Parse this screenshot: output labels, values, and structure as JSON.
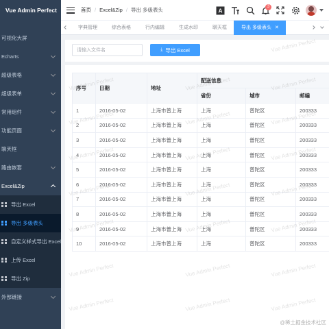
{
  "app": {
    "title": "Vue Admin Perfect"
  },
  "sidebar": {
    "items": [
      {
        "label": "可视化大屏",
        "arrow": false
      },
      {
        "label": "Echarts",
        "arrow": true
      },
      {
        "label": "超级表格",
        "arrow": true
      },
      {
        "label": "超级表单",
        "arrow": true
      },
      {
        "label": "常用组件",
        "arrow": true
      },
      {
        "label": "功能页面",
        "arrow": true
      },
      {
        "label": "聊天框",
        "arrow": false
      },
      {
        "label": "路由嵌套",
        "arrow": true
      }
    ],
    "open_group": {
      "label": "Excel&Zip",
      "children": [
        {
          "label": "导出 Excel",
          "active": false
        },
        {
          "label": "导出 多级表头",
          "active": true
        },
        {
          "label": "自定义样式导出 Excel",
          "active": false
        },
        {
          "label": "上传 Excel",
          "active": false
        },
        {
          "label": "导出 Zip",
          "active": false
        }
      ]
    },
    "after_items": [
      {
        "label": "外部链接",
        "arrow": true
      }
    ]
  },
  "header": {
    "breadcrumb": [
      "首页",
      "Excel&Zip",
      "导出 多级表头"
    ],
    "notification_count": "3",
    "icons": [
      "font-size-icon",
      "text-height-icon",
      "search-icon",
      "bell-icon",
      "fullscreen-icon",
      "settings-icon"
    ]
  },
  "tabs": [
    {
      "label": "字典管理",
      "active": false
    },
    {
      "label": "综合表格",
      "active": false
    },
    {
      "label": "行内编辑",
      "active": false
    },
    {
      "label": "生成水印",
      "active": false
    },
    {
      "label": "聊天框",
      "active": false
    },
    {
      "label": "导出 多级表头",
      "active": true
    }
  ],
  "toolbar": {
    "search_placeholder": "请输入文件名",
    "export_label": "导出 Excel"
  },
  "table": {
    "headers": {
      "index": "序号",
      "date": "日期",
      "address": "地址",
      "group": "配送信息",
      "province": "省份",
      "city": "城市",
      "zip": "邮编"
    },
    "rows": [
      [
        "1",
        "2016-05-02",
        "上海市普上海",
        "上海",
        "普陀区",
        "200333"
      ],
      [
        "2",
        "2016-05-02",
        "上海市普上海",
        "上海",
        "普陀区",
        "200333"
      ],
      [
        "3",
        "2016-05-02",
        "上海市普上海",
        "上海",
        "普陀区",
        "200333"
      ],
      [
        "4",
        "2016-05-02",
        "上海市普上海",
        "上海",
        "普陀区",
        "200333"
      ],
      [
        "5",
        "2016-05-02",
        "上海市普上海",
        "上海",
        "普陀区",
        "200333"
      ],
      [
        "6",
        "2016-05-02",
        "上海市普上海",
        "上海",
        "普陀区",
        "200333"
      ],
      [
        "7",
        "2016-05-02",
        "上海市普上海",
        "上海",
        "普陀区",
        "200333"
      ],
      [
        "8",
        "2016-05-02",
        "上海市普上海",
        "上海",
        "普陀区",
        "200333"
      ],
      [
        "9",
        "2016-05-02",
        "上海市普上海",
        "上海",
        "普陀区",
        "200333"
      ],
      [
        "10",
        "2016-05-02",
        "上海市普上海",
        "上海",
        "普陀区",
        "200333"
      ]
    ]
  },
  "watermark": {
    "text": "Vue Admin Perfect"
  },
  "source_mark": "@稀土掘金技术社区",
  "colors": {
    "sidebar_bg": "#304156",
    "submenu_bg": "#1f2d3d",
    "accent": "#409eff",
    "badge": "#f56c6c"
  }
}
